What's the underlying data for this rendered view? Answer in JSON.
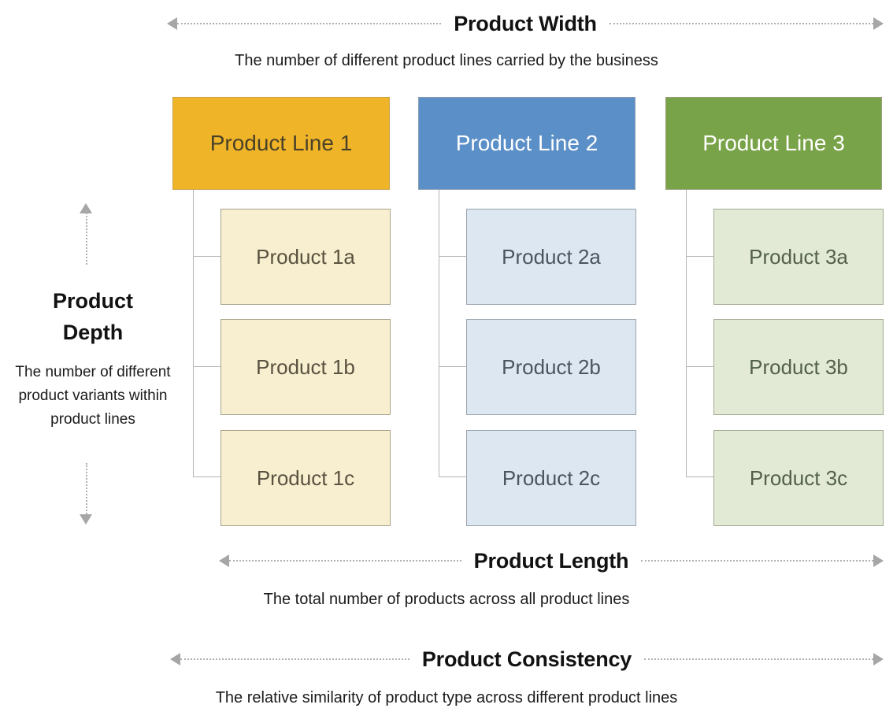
{
  "axes": {
    "width": {
      "title": "Product Width",
      "subtitle": "The number of different product lines carried by the business"
    },
    "depth": {
      "title_line1": "Product",
      "title_line2": "Depth",
      "subtitle": "The number of different product variants within product lines"
    },
    "length": {
      "title": "Product Length",
      "subtitle": "The total number of products across all product lines"
    },
    "consistency": {
      "title": "Product Consistency",
      "subtitle": "The relative similarity of product type across different product lines"
    }
  },
  "columns": [
    {
      "header": "Product Line 1",
      "header_bg": "#f0b429",
      "header_text": "#4a4228",
      "header_border": "#c9a24a",
      "variant_bg": "#f7efcf",
      "variant_text": "#5a5240",
      "variant_border": "#a8a28c",
      "variants": [
        "Product 1a",
        "Product 1b",
        "Product 1c"
      ]
    },
    {
      "header": "Product Line 2",
      "header_bg": "#5b8fc7",
      "header_text": "#ffffff",
      "header_border": "#8d9db0",
      "variant_bg": "#dde7f2",
      "variant_text": "#4a5560",
      "variant_border": "#9aa4ae",
      "variants": [
        "Product 2a",
        "Product 2b",
        "Product 2c"
      ]
    },
    {
      "header": "Product Line 3",
      "header_bg": "#79a košice",
      "header_bg_hex": "#79a348",
      "header_text": "#ffffff",
      "header_border": "#9aa07e",
      "variant_bg": "#e2ead5",
      "variant_text": "#53604a",
      "variant_border": "#a2aa93",
      "variants": [
        "Product 3a",
        "Product 3b",
        "Product 3c"
      ]
    }
  ],
  "connector_color": "#b5b5b5",
  "arrow_color": "#a6a6a6"
}
